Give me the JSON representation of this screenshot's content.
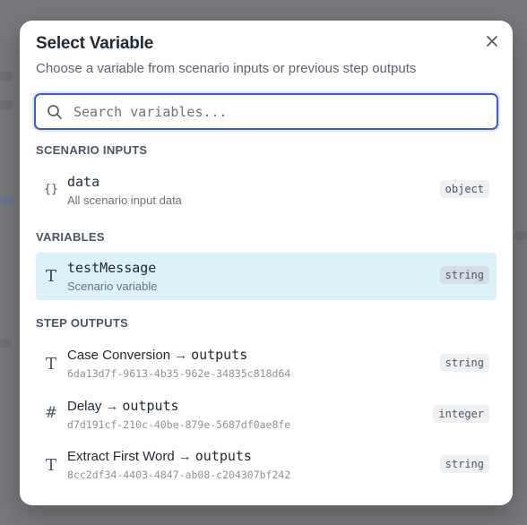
{
  "dialog": {
    "title": "Select Variable",
    "subtitle": "Choose a variable from scenario inputs or previous step outputs",
    "close_icon": "close-icon"
  },
  "search": {
    "placeholder": "Search variables...",
    "value": ""
  },
  "sections": {
    "scenario_inputs": {
      "label": "SCENARIO INPUTS",
      "items": [
        {
          "icon": "braces-icon",
          "name": "data",
          "description": "All scenario input data",
          "type": "object"
        }
      ]
    },
    "variables": {
      "label": "VARIABLES",
      "items": [
        {
          "icon": "text-type-icon",
          "name": "testMessage",
          "description": "Scenario variable",
          "type": "string",
          "selected": true
        }
      ]
    },
    "step_outputs": {
      "label": "STEP OUTPUTS",
      "items": [
        {
          "icon": "text-type-icon",
          "step": "Case Conversion",
          "arrow": "→",
          "field": "outputs",
          "id": "6da13d7f-9613-4b35-962e-34835c818d64",
          "type": "string"
        },
        {
          "icon": "hash-icon",
          "step": "Delay",
          "arrow": "→",
          "field": "outputs",
          "id": "d7d191cf-210c-40be-879e-5687df0ae8fe",
          "type": "integer"
        },
        {
          "icon": "text-type-icon",
          "step": "Extract First Word",
          "arrow": "→",
          "field": "outputs",
          "id": "8cc2df34-4403-4847-ab08-c204307bf242",
          "type": "string"
        }
      ]
    }
  },
  "colors": {
    "accent": "#3b5bdb",
    "selected_bg": "#dbf2fb",
    "overlay": "#7d7f82"
  }
}
